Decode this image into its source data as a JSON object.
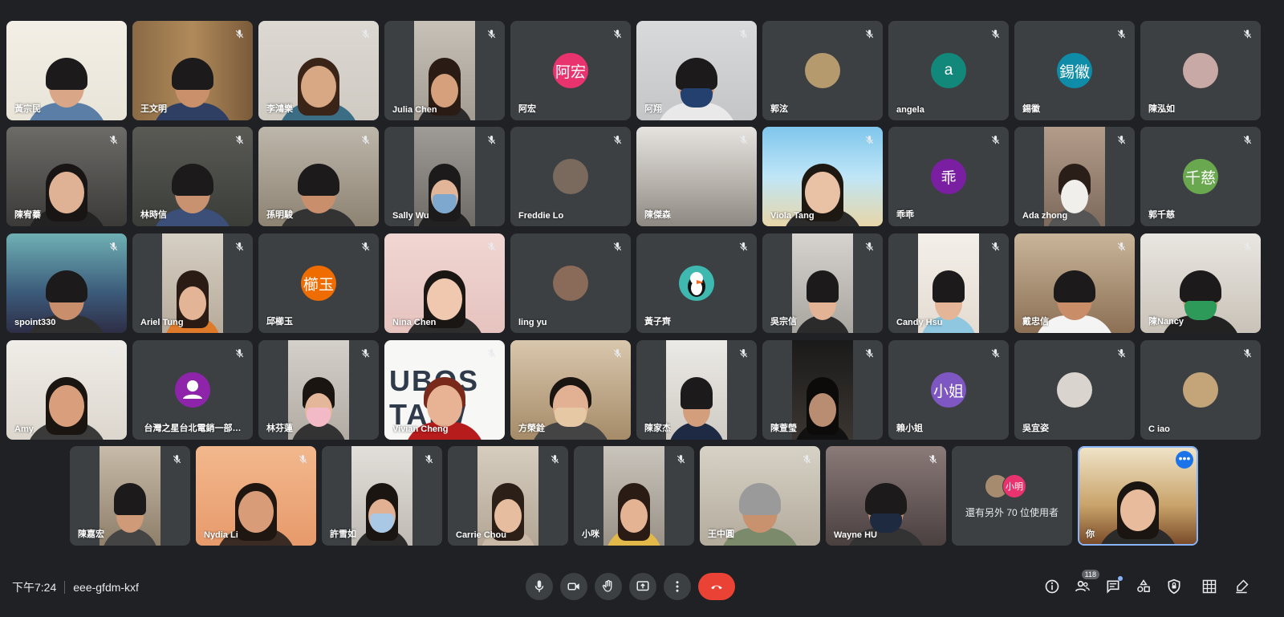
{
  "meeting": {
    "time": "下午7:24",
    "code": "eee-gfdm-kxf"
  },
  "participants": [
    [
      "黃宗民",
      "王文明",
      "李鴻樂",
      "Julia Chen",
      "阿宏",
      "阿翔",
      "郭泫",
      "angela",
      "錫徽",
      "陳泓如"
    ],
    [
      "陳宥蓁",
      "林時信",
      "孫明駿",
      "Sally Wu",
      "Freddie Lo",
      "陳傑森",
      "Viola Tang",
      "乖乖",
      "Ada zhong",
      "郭千慈"
    ],
    [
      "spoint330",
      "Ariel Tung",
      "邱櫛玉",
      "Nina Chen",
      "ling yu",
      "黃子齊",
      "吳宗信",
      "Candy Hsu",
      "戴忠信",
      "陳Nancy"
    ],
    [
      "Amy",
      "台灣之星台北電銷一部…",
      "林芬蓮",
      "Vivian Cheng",
      "方榮銓",
      "陳家杰",
      "陳萱瑩",
      "賴小姐",
      "吳宜姿",
      "C iao"
    ],
    [
      "陳嘉宏",
      "Nydia Li",
      "許雪如",
      "Carrie Chou",
      "小咪",
      "王中圓",
      "Wayne HU",
      "還有另外 70 位使用者",
      "你"
    ]
  ],
  "avatars": {
    "ahong": "阿宏",
    "angela": "a",
    "xihui": "錫徽",
    "guai": "乖",
    "qianci": "千慈",
    "zhiyu": "櫛玉",
    "xiaojie": "小姐",
    "overflow": "小明"
  },
  "controls": {
    "participant_count": "118",
    "icons": [
      "mic-icon",
      "camera-icon",
      "raise-hand-icon",
      "present-icon",
      "more-options-icon",
      "hang-up-icon"
    ],
    "tools": [
      "info-icon",
      "people-icon",
      "chat-icon",
      "activities-icon",
      "host-controls-icon",
      "grid-icon",
      "whiteboard-icon"
    ]
  },
  "colors": {
    "background": "#202124",
    "tile": "#3c4043",
    "hangup": "#ea4335",
    "accent": "#8ab4f8",
    "ahong": "#e8336f",
    "angela": "#12887a",
    "xihui": "#0f8ca8",
    "guai": "#7b1fa2",
    "qianci": "#6aa84f",
    "zhiyu": "#ef6c00",
    "xiaojie": "#7e57c2"
  },
  "vivian_sign": "UBOS TAIW"
}
